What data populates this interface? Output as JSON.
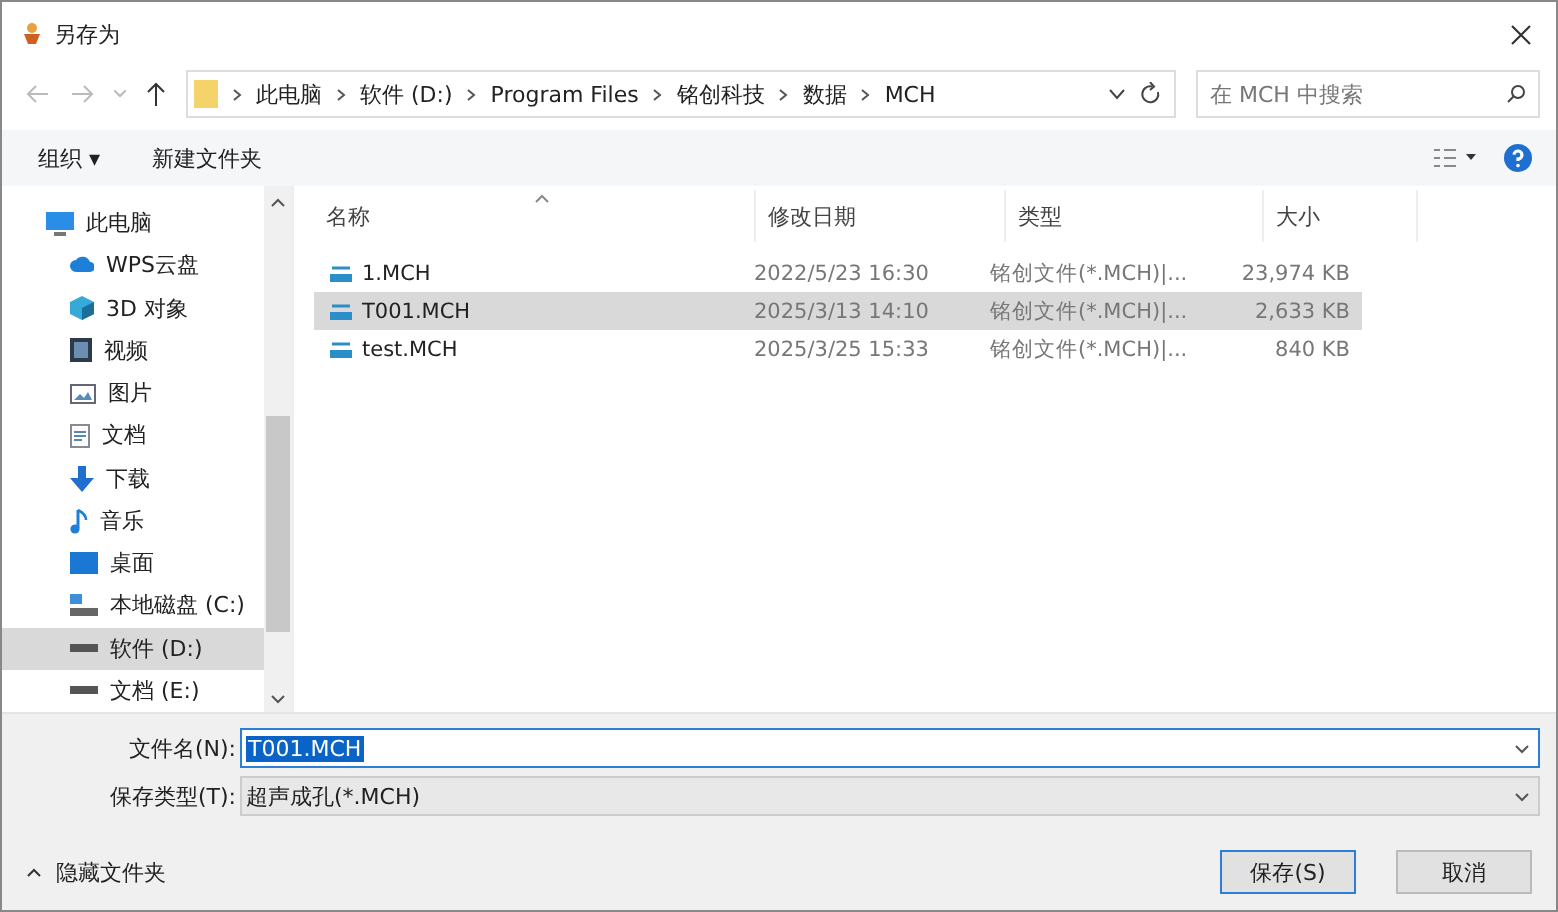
{
  "window": {
    "title": "另存为"
  },
  "address": {
    "segments": [
      "此电脑",
      "软件 (D:)",
      "Program Files",
      "铭创科技",
      "数据",
      "MCH"
    ]
  },
  "search": {
    "placeholder": "在 MCH 中搜索"
  },
  "toolbar": {
    "organize": "组织 ▾",
    "new_folder": "新建文件夹"
  },
  "sidebar": {
    "items": [
      {
        "label": "此电脑",
        "kind": "pc",
        "selected": false
      },
      {
        "label": "WPS云盘",
        "kind": "cloud",
        "selected": false
      },
      {
        "label": "3D 对象",
        "kind": "cube",
        "selected": false
      },
      {
        "label": "视频",
        "kind": "video",
        "selected": false
      },
      {
        "label": "图片",
        "kind": "picture",
        "selected": false
      },
      {
        "label": "文档",
        "kind": "document",
        "selected": false
      },
      {
        "label": "下载",
        "kind": "download",
        "selected": false
      },
      {
        "label": "音乐",
        "kind": "music",
        "selected": false
      },
      {
        "label": "桌面",
        "kind": "desktop",
        "selected": false
      },
      {
        "label": "本地磁盘 (C:)",
        "kind": "systemdrive",
        "selected": false
      },
      {
        "label": "软件 (D:)",
        "kind": "drive",
        "selected": true
      },
      {
        "label": "文档 (E:)",
        "kind": "drive",
        "selected": false
      }
    ]
  },
  "table": {
    "columns": [
      "名称",
      "修改日期",
      "类型",
      "大小"
    ],
    "rows": [
      {
        "name": "1.MCH",
        "modified": "2022/5/23 16:30",
        "type": "铭创文件(*.MCH)|...",
        "size": "23,974 KB",
        "selected": false
      },
      {
        "name": "T001.MCH",
        "modified": "2025/3/13 14:10",
        "type": "铭创文件(*.MCH)|...",
        "size": "2,633 KB",
        "selected": true
      },
      {
        "name": "test.MCH",
        "modified": "2025/3/25 15:33",
        "type": "铭创文件(*.MCH)|...",
        "size": "840 KB",
        "selected": false
      }
    ]
  },
  "filename": {
    "label": "文件名(N):",
    "value": "T001.MCH"
  },
  "filetype": {
    "label": "保存类型(T):",
    "value": "超声成孔(*.MCH)"
  },
  "hide_folders": "隐藏文件夹",
  "buttons": {
    "save": "保存(S)",
    "cancel": "取消"
  }
}
